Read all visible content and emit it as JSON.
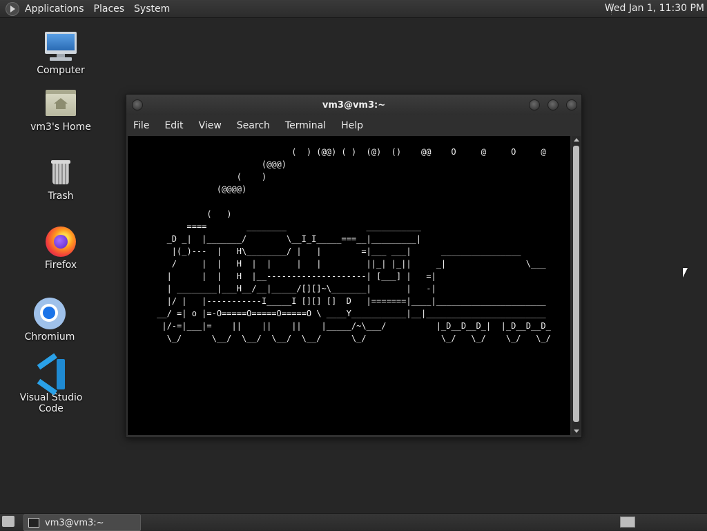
{
  "top_panel": {
    "menus": [
      "Applications",
      "Places",
      "System"
    ],
    "clock": "Wed Jan  1, 11:30 PM"
  },
  "desktop_icons": [
    {
      "label": "Computer",
      "icon": "computer-icon"
    },
    {
      "label": "vm3's Home",
      "icon": "home-folder-icon"
    },
    {
      "label": "Trash",
      "icon": "trash-icon"
    },
    {
      "label": "Firefox",
      "icon": "firefox-icon"
    },
    {
      "label": "Chromium",
      "icon": "chromium-icon"
    },
    {
      "label": "Visual Studio Code",
      "icon": "vscode-icon"
    }
  ],
  "terminal": {
    "title": "vm3@vm3:~",
    "menu": [
      "File",
      "Edit",
      "View",
      "Search",
      "Terminal",
      "Help"
    ],
    "output": "                                (  ) (@@) ( )  (@)  ()    @@    O     @     O     @\n                          (@@@)\n                     (    )\n                 (@@@@)\n\n               (   )\n           ====        ________                ___________\n       _D _|  |_______/        \\__I_I_____===__|_________|\n        |(_)---  |   H\\________/ |   |        =|___ ___|      ________________\n        /     |  |   H  |  |     |   |         ||_| |_||     _|                \\___\n       |      |  |   H  |__--------------------| [___] |   =|\n       | ________|___H__/__|_____/[][]~\\_______|       |   -|\n       |/ |   |-----------I_____I [][] []  D   |=======|____|______________________\n     __/ =| o |=-O=====O=====O=====O \\ ____Y___________|__|________________________\n      |/-=|___|=    ||    ||    ||    |_____/~\\___/          |_D__D__D_|  |_D__D__D_\n       \\_/      \\__/  \\__/  \\__/  \\__/      \\_/               \\_/   \\_/    \\_/   \\_/"
  },
  "taskbar": {
    "task_label": "vm3@vm3:~"
  }
}
